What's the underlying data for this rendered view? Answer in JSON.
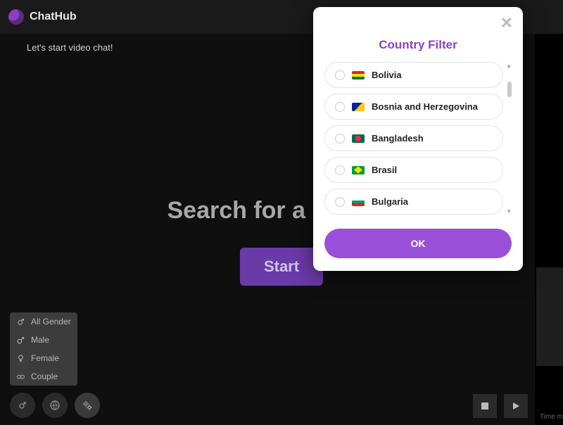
{
  "header": {
    "app_name": "ChatHub"
  },
  "status": {
    "message": "Let's start video chat!"
  },
  "hero": {
    "title": "Search for a Partner",
    "start_label": "Start"
  },
  "gender_menu": {
    "items": [
      {
        "label": "All Gender"
      },
      {
        "label": "Male"
      },
      {
        "label": "Female"
      },
      {
        "label": "Couple"
      }
    ]
  },
  "modal": {
    "title": "Country Filter",
    "ok_label": "OK",
    "countries": [
      {
        "label": "Bolivia",
        "flag": "bo"
      },
      {
        "label": "Bosnia and Herzegovina",
        "flag": "ba"
      },
      {
        "label": "Bangladesh",
        "flag": "bd"
      },
      {
        "label": "Brasil",
        "flag": "br"
      },
      {
        "label": "Bulgaria",
        "flag": "bg"
      }
    ]
  },
  "footer": {
    "time_hint": "Time m"
  }
}
